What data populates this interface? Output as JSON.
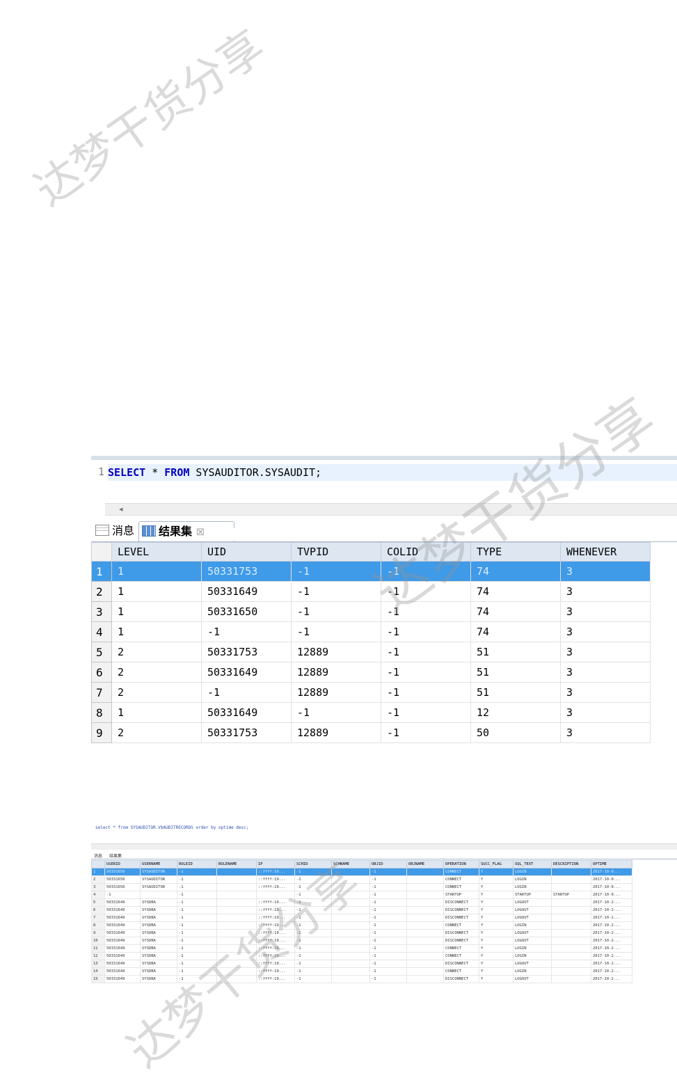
{
  "watermark": "达梦干货分享",
  "shot1": {
    "line_number": "1",
    "sql": {
      "kw1": "SELECT",
      "star": " * ",
      "kw2": "FROM",
      "rest": " SYSAUDITOR.SYSAUDIT;"
    },
    "scroll_left": "◂",
    "tabs": {
      "messages": "消息",
      "results": "结果集",
      "close": "☒"
    },
    "columns": [
      "LEVEL",
      "UID",
      "TVPID",
      "COLID",
      "TYPE",
      "WHENEVER"
    ],
    "rows": [
      [
        "1",
        "1",
        "50331753",
        "-1",
        "-1",
        "74",
        "3"
      ],
      [
        "2",
        "1",
        "50331649",
        "-1",
        "-1",
        "74",
        "3"
      ],
      [
        "3",
        "1",
        "50331650",
        "-1",
        "-1",
        "74",
        "3"
      ],
      [
        "4",
        "1",
        "-1",
        "-1",
        "-1",
        "74",
        "3"
      ],
      [
        "5",
        "2",
        "50331753",
        "12889",
        "-1",
        "51",
        "3"
      ],
      [
        "6",
        "2",
        "50331649",
        "12889",
        "-1",
        "51",
        "3"
      ],
      [
        "7",
        "2",
        "-1",
        "12889",
        "-1",
        "51",
        "3"
      ],
      [
        "8",
        "1",
        "50331649",
        "-1",
        "-1",
        "12",
        "3"
      ],
      [
        "9",
        "2",
        "50331753",
        "12889",
        "-1",
        "50",
        "3"
      ]
    ],
    "selected_row": 0
  },
  "shot2": {
    "sql": "select * from SYSAUDITOR.V$AUDITRECORDS order by optime desc;",
    "tabs": {
      "messages": "消息",
      "results": "结果集"
    },
    "columns": [
      "USERID",
      "USERNAME",
      "ROLEID",
      "ROLENAME",
      "IP",
      "SCHID",
      "SCHNAME",
      "OBJID",
      "OBJNAME",
      "OPERATION",
      "SUCC_FLAG",
      "SQL_TEXT",
      "DESCRIPTION",
      "OPTIME"
    ],
    "rows": [
      [
        "1",
        "50331650",
        "SYSAUDITOR",
        "-1",
        "",
        "::ffff:19...",
        "-1",
        "",
        "-1",
        "",
        "CONNECT",
        "Y",
        "LOGIN",
        "",
        "2017-10-0..."
      ],
      [
        "2",
        "50331650",
        "SYSAUDITOR",
        "-1",
        "",
        "::ffff:19...",
        "-1",
        "",
        "-1",
        "",
        "CONNECT",
        "Y",
        "LOGIN",
        "",
        "2017-10-0..."
      ],
      [
        "3",
        "50331650",
        "SYSAUDITOR",
        "-1",
        "",
        "::ffff:19...",
        "-1",
        "",
        "-1",
        "",
        "CONNECT",
        "Y",
        "LOGIN",
        "",
        "2017-10-0..."
      ],
      [
        "4",
        "-1",
        "",
        "-1",
        "",
        "",
        "-1",
        "",
        "-1",
        "",
        "STARTUP",
        "Y",
        "STARTUP",
        "STARTUP",
        "2017-10-0..."
      ],
      [
        "5",
        "50331649",
        "SYSDBA",
        "-1",
        "",
        "::ffff:19...",
        "-1",
        "",
        "-1",
        "",
        "DISCONNECT",
        "Y",
        "LOGOUT",
        "",
        "2017-10-2..."
      ],
      [
        "6",
        "50331649",
        "SYSDBA",
        "-1",
        "",
        "::ffff:19...",
        "-1",
        "",
        "-1",
        "",
        "DISCONNECT",
        "Y",
        "LOGOUT",
        "",
        "2017-10-2..."
      ],
      [
        "7",
        "50331649",
        "SYSDBA",
        "-1",
        "",
        "::ffff:19...",
        "-1",
        "",
        "-1",
        "",
        "DISCONNECT",
        "Y",
        "LOGOUT",
        "",
        "2017-10-2..."
      ],
      [
        "8",
        "50331649",
        "SYSDBA",
        "-1",
        "",
        "::ffff:19...",
        "-1",
        "",
        "-1",
        "",
        "CONNECT",
        "Y",
        "LOGIN",
        "",
        "2017-10-2..."
      ],
      [
        "9",
        "50331649",
        "SYSDBA",
        "-1",
        "",
        "::ffff:19...",
        "-1",
        "",
        "-1",
        "",
        "DISCONNECT",
        "Y",
        "LOGOUT",
        "",
        "2017-10-2..."
      ],
      [
        "10",
        "50331649",
        "SYSDBA",
        "-1",
        "",
        "::ffff:19...",
        "-1",
        "",
        "-1",
        "",
        "DISCONNECT",
        "Y",
        "LOGOUT",
        "",
        "2017-10-2..."
      ],
      [
        "11",
        "50331649",
        "SYSDBA",
        "-1",
        "",
        "::ffff:19...",
        "-1",
        "",
        "-1",
        "",
        "CONNECT",
        "Y",
        "LOGIN",
        "",
        "2017-10-2..."
      ],
      [
        "12",
        "50331649",
        "SYSDBA",
        "-1",
        "",
        "::ffff:19...",
        "-1",
        "",
        "-1",
        "",
        "CONNECT",
        "Y",
        "LOGIN",
        "",
        "2017-10-2..."
      ],
      [
        "13",
        "50331649",
        "SYSDBA",
        "-1",
        "",
        "::ffff:19...",
        "-1",
        "",
        "-1",
        "",
        "DISCONNECT",
        "Y",
        "LOGOUT",
        "",
        "2017-10-2..."
      ],
      [
        "14",
        "50331649",
        "SYSDBA",
        "-1",
        "",
        "::ffff:19...",
        "-1",
        "",
        "-1",
        "",
        "CONNECT",
        "Y",
        "LOGIN",
        "",
        "2017-10-2..."
      ],
      [
        "15",
        "50331649",
        "SYSDBA",
        "-1",
        "",
        "::ffff:19...",
        "-1",
        "",
        "-1",
        "",
        "DISCONNECT",
        "Y",
        "LOGOUT",
        "",
        "2017-10-2..."
      ]
    ]
  }
}
